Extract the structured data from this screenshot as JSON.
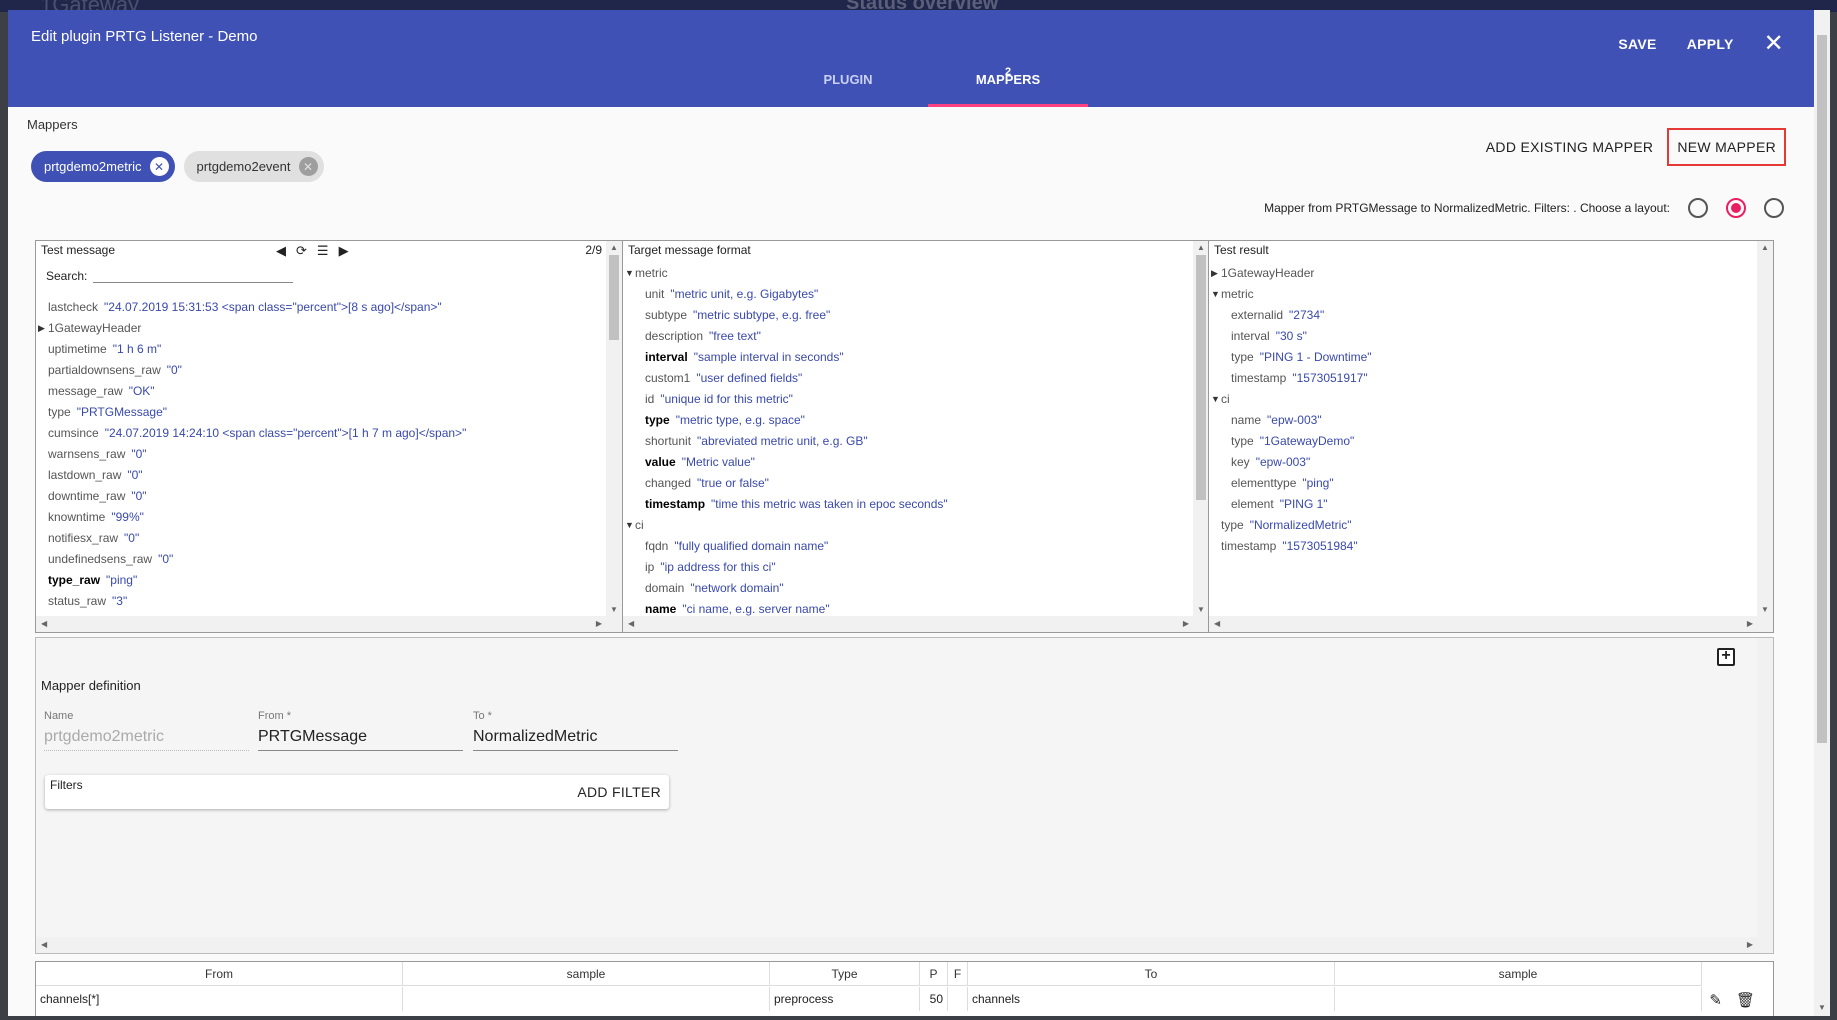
{
  "background": {
    "title": "Status overview",
    "logo": "1Gateway"
  },
  "dialog": {
    "title": "Edit plugin PRTG Listener - Demo",
    "actions": {
      "save": "SAVE",
      "apply": "APPLY",
      "close": "✕"
    },
    "tabs": [
      {
        "label": "PLUGIN",
        "badge": ""
      },
      {
        "label": "MAPPERS",
        "badge": "2"
      }
    ]
  },
  "mappers": {
    "section_label": "Mappers",
    "add_existing": "ADD EXISTING MAPPER",
    "new_mapper": "NEW MAPPER",
    "chips": [
      {
        "label": "prtgdemo2metric",
        "selected": true
      },
      {
        "label": "prtgdemo2event",
        "selected": false
      }
    ],
    "layout_text": "Mapper from PRTGMessage to NormalizedMetric. Filters: . Choose a layout:"
  },
  "test_message": {
    "title": "Test message",
    "page": "2/9",
    "search_label": "Search:",
    "rows": [
      {
        "key": "lastcheck",
        "value": "\"24.07.2019 15:31:53 <span class=\"percent\">[8 s ago]</span>\"",
        "bold": false,
        "toggle": ""
      },
      {
        "key": "1GatewayHeader",
        "value": "",
        "bold": false,
        "toggle": "▶"
      },
      {
        "key": "uptimetime",
        "value": "\"1 h 6 m\"",
        "bold": false,
        "toggle": ""
      },
      {
        "key": "partialdownsens_raw",
        "value": "\"0\"",
        "bold": false,
        "toggle": ""
      },
      {
        "key": "message_raw",
        "value": "\"OK\"",
        "bold": false,
        "toggle": ""
      },
      {
        "key": "type",
        "value": "\"PRTGMessage\"",
        "bold": false,
        "toggle": ""
      },
      {
        "key": "cumsince",
        "value": "\"24.07.2019 14:24:10 <span class=\"percent\">[1 h 7 m ago]</span>\"",
        "bold": false,
        "toggle": ""
      },
      {
        "key": "warnsens_raw",
        "value": "\"0\"",
        "bold": false,
        "toggle": ""
      },
      {
        "key": "lastdown_raw",
        "value": "\"0\"",
        "bold": false,
        "toggle": ""
      },
      {
        "key": "downtime_raw",
        "value": "\"0\"",
        "bold": false,
        "toggle": ""
      },
      {
        "key": "knowntime",
        "value": "\"99%\"",
        "bold": false,
        "toggle": ""
      },
      {
        "key": "notifiesx_raw",
        "value": "\"0\"",
        "bold": false,
        "toggle": ""
      },
      {
        "key": "undefinedsens_raw",
        "value": "\"0\"",
        "bold": false,
        "toggle": ""
      },
      {
        "key": "type_raw",
        "value": "\"ping\"",
        "bold": true,
        "toggle": ""
      },
      {
        "key": "status_raw",
        "value": "\"3\"",
        "bold": false,
        "toggle": ""
      }
    ]
  },
  "target_format": {
    "title": "Target message format",
    "rows": [
      {
        "key": "metric",
        "value": "",
        "bold": false,
        "toggle": "▼",
        "level": 0
      },
      {
        "key": "unit",
        "value": "\"metric unit, e.g. Gigabytes\"",
        "bold": false,
        "toggle": "",
        "level": 1
      },
      {
        "key": "subtype",
        "value": "\"metric subtype, e.g. free\"",
        "bold": false,
        "toggle": "",
        "level": 1
      },
      {
        "key": "description",
        "value": "\"free text\"",
        "bold": false,
        "toggle": "",
        "level": 1
      },
      {
        "key": "interval",
        "value": "\"sample interval in seconds\"",
        "bold": true,
        "toggle": "",
        "level": 1
      },
      {
        "key": "custom1",
        "value": "\"user defined fields\"",
        "bold": false,
        "toggle": "",
        "level": 1
      },
      {
        "key": "id",
        "value": "\"unique id for this metric\"",
        "bold": false,
        "toggle": "",
        "level": 1
      },
      {
        "key": "type",
        "value": "\"metric type, e.g. space\"",
        "bold": true,
        "toggle": "",
        "level": 1
      },
      {
        "key": "shortunit",
        "value": "\"abreviated metric unit, e.g. GB\"",
        "bold": false,
        "toggle": "",
        "level": 1
      },
      {
        "key": "value",
        "value": "\"Metric value\"",
        "bold": true,
        "toggle": "",
        "level": 1
      },
      {
        "key": "changed",
        "value": "\"true or false\"",
        "bold": false,
        "toggle": "",
        "level": 1
      },
      {
        "key": "timestamp",
        "value": "\"time this metric was taken in epoc seconds\"",
        "bold": true,
        "toggle": "",
        "level": 1
      },
      {
        "key": "ci",
        "value": "",
        "bold": false,
        "toggle": "▼",
        "level": 0
      },
      {
        "key": "fqdn",
        "value": "\"fully qualified domain name\"",
        "bold": false,
        "toggle": "",
        "level": 1
      },
      {
        "key": "ip",
        "value": "\"ip address for this ci\"",
        "bold": false,
        "toggle": "",
        "level": 1
      },
      {
        "key": "domain",
        "value": "\"network domain\"",
        "bold": false,
        "toggle": "",
        "level": 1
      },
      {
        "key": "name",
        "value": "\"ci name, e.g. server name\"",
        "bold": true,
        "toggle": "",
        "level": 1
      }
    ]
  },
  "test_result": {
    "title": "Test result",
    "rows": [
      {
        "key": "1GatewayHeader",
        "value": "",
        "bold": false,
        "toggle": "▶",
        "level": 0
      },
      {
        "key": "metric",
        "value": "",
        "bold": false,
        "toggle": "▼",
        "level": 0
      },
      {
        "key": "externalid",
        "value": "\"2734\"",
        "bold": false,
        "toggle": "",
        "level": 1
      },
      {
        "key": "interval",
        "value": "\"30 s\"",
        "bold": false,
        "toggle": "",
        "level": 1
      },
      {
        "key": "type",
        "value": "\"PING 1 - Downtime\"",
        "bold": false,
        "toggle": "",
        "level": 1
      },
      {
        "key": "timestamp",
        "value": "\"1573051917\"",
        "bold": false,
        "toggle": "",
        "level": 1
      },
      {
        "key": "ci",
        "value": "",
        "bold": false,
        "toggle": "▼",
        "level": 0
      },
      {
        "key": "name",
        "value": "\"epw-003\"",
        "bold": false,
        "toggle": "",
        "level": 1
      },
      {
        "key": "type",
        "value": "\"1GatewayDemo\"",
        "bold": false,
        "toggle": "",
        "level": 1
      },
      {
        "key": "key",
        "value": "\"epw-003\"",
        "bold": false,
        "toggle": "",
        "level": 1
      },
      {
        "key": "elementtype",
        "value": "\"ping\"",
        "bold": false,
        "toggle": "",
        "level": 1
      },
      {
        "key": "element",
        "value": "\"PING 1\"",
        "bold": false,
        "toggle": "",
        "level": 1
      },
      {
        "key": "type",
        "value": "\"NormalizedMetric\"",
        "bold": false,
        "toggle": "",
        "level": 0
      },
      {
        "key": "timestamp",
        "value": "\"1573051984\"",
        "bold": false,
        "toggle": "",
        "level": 0
      }
    ]
  },
  "definition": {
    "title": "Mapper definition",
    "name_label": "Name",
    "name_value": "prtgdemo2metric",
    "from_label": "From *",
    "from_value": "PRTGMessage",
    "to_label": "To *",
    "to_value": "NormalizedMetric",
    "filters_label": "Filters",
    "add_filter": "ADD FILTER"
  },
  "mapping_table": {
    "headers": [
      "From",
      "sample",
      "Type",
      "P",
      "F",
      "To",
      "sample"
    ],
    "rows": [
      [
        "channels[*]",
        "",
        "preprocess",
        "50",
        "",
        "channels",
        ""
      ]
    ]
  },
  "colors": {
    "app_bar": "#3f51b5",
    "accent": "#e91e63",
    "highlight_border": "#e53935",
    "value_text": "#3949ab"
  }
}
